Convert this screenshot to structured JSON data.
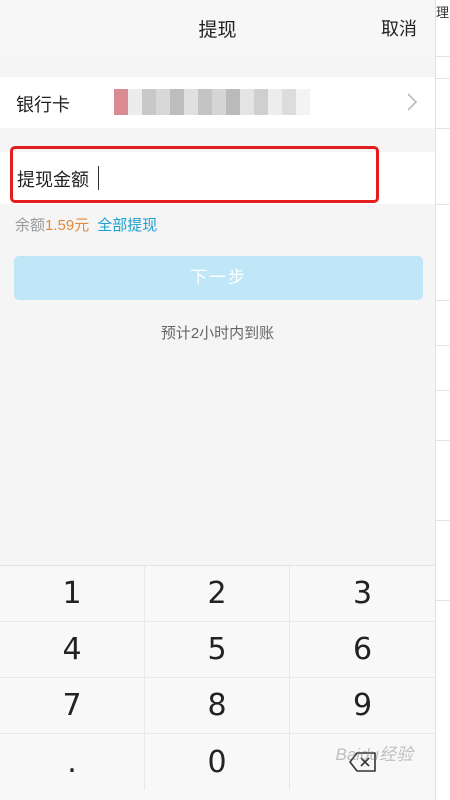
{
  "header": {
    "title": "提现",
    "cancel_label": "取消"
  },
  "right_strip": {
    "text": "理"
  },
  "bank": {
    "label": "银行卡",
    "account_masked": true
  },
  "amount": {
    "label": "提现金额",
    "value": "",
    "placeholder": ""
  },
  "balance": {
    "label": "余额",
    "amount": "1.59元",
    "withdraw_all_label": "全部提现"
  },
  "next_button": {
    "label": "下一步",
    "enabled": false
  },
  "eta_text": "预计2小时内到账",
  "keypad": {
    "keys": [
      "1",
      "2",
      "3",
      "4",
      "5",
      "6",
      "7",
      "8",
      "9",
      ".",
      "0"
    ],
    "backspace_icon": "backspace-icon"
  },
  "watermark": "Baidu经验",
  "colors": {
    "accent": "#1aa0d0",
    "balance_amount": "#e08a3c",
    "next_button_disabled": "#bfe7f8",
    "highlight_box": "#e41e1e"
  }
}
